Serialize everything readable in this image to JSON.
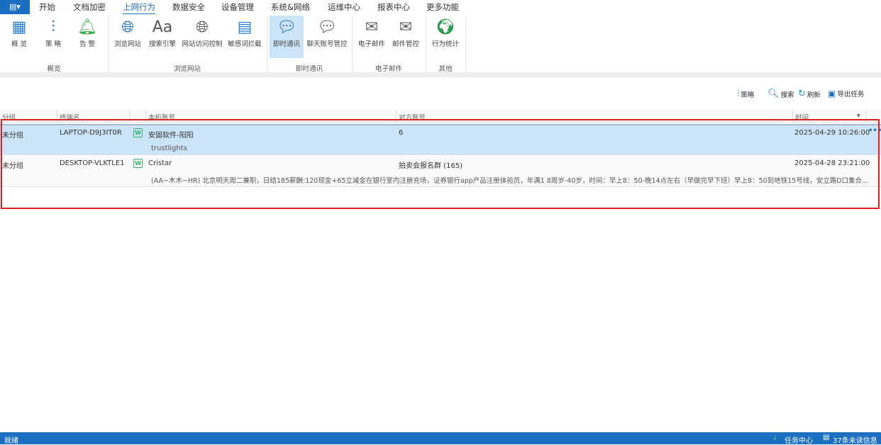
{
  "menu": {
    "app_icon": "document-menu-icon",
    "tabs": [
      "开始",
      "文档加密",
      "上网行为",
      "数据安全",
      "设备管理",
      "系统&网络",
      "运维中心",
      "报表中心",
      "更多功能"
    ],
    "active": "上网行为"
  },
  "ribbon": {
    "groups": [
      {
        "label": "概览",
        "items": [
          {
            "label": "概 览",
            "icon": "grid-icon"
          },
          {
            "label": "策 略",
            "icon": "sliders-icon"
          },
          {
            "label": "告 警",
            "icon": "bell-icon"
          }
        ]
      },
      {
        "label": "浏览网站",
        "items": [
          {
            "label": "浏览网站",
            "icon": "globe-icon"
          },
          {
            "label": "搜索引擎",
            "icon": "font-aa-icon"
          },
          {
            "label": "网站访问控制",
            "icon": "globe-check-icon"
          },
          {
            "label": "敏感词拦截",
            "icon": "window-shield-icon"
          }
        ]
      },
      {
        "label": "即时通讯",
        "items": [
          {
            "label": "即时通讯",
            "icon": "chat-icon",
            "selected": true
          },
          {
            "label": "聊天账号管控",
            "icon": "chat-user-icon"
          }
        ]
      },
      {
        "label": "电子邮件",
        "items": [
          {
            "label": "电子邮件",
            "icon": "envelope-icon"
          },
          {
            "label": "邮件管控",
            "icon": "envelope-shield-icon"
          }
        ]
      },
      {
        "label": "其他",
        "items": [
          {
            "label": "行为统计",
            "icon": "globe-stats-icon"
          }
        ]
      }
    ]
  },
  "toolbar": {
    "policy": "策略",
    "search": "搜索",
    "refresh": "刷新",
    "export": "导出任务"
  },
  "table": {
    "columns": [
      "分组",
      "终端名",
      "本机账号",
      "对方账号",
      "时间"
    ],
    "rows": [
      {
        "group": "未分组",
        "terminal": "LAPTOP-D9J3IT0R",
        "app": "W",
        "account": "安固软件-阳阳",
        "peer": "6",
        "time": "2025-04-29 10:26:00",
        "message": "trustlights",
        "selected": true
      },
      {
        "group": "未分组",
        "terminal": "DESKTOP-VLKTLE1",
        "app": "W",
        "account": "Cristar",
        "peer": "拍卖会报名群 (165)",
        "time": "2025-04-28 23:21:00",
        "message": "(AA~木木~HR) 北京明天周二兼职，日结185薪酬:120现金+65立减金在银行室内注册充场，证券银行app产品注册体验员，年满1 8周岁-40岁，时间：早上8：50-晚14点左右（早做完早下班）早上8：50到地铁15号线，安立路D口集合..."
      }
    ]
  },
  "status": {
    "left": "就绪",
    "task_center": "任务中心",
    "unread": "37条未读信息"
  },
  "colors": {
    "accent": "#1a6fc0",
    "selected_row": "#cce4f7",
    "highlight_box": "#e02020"
  }
}
